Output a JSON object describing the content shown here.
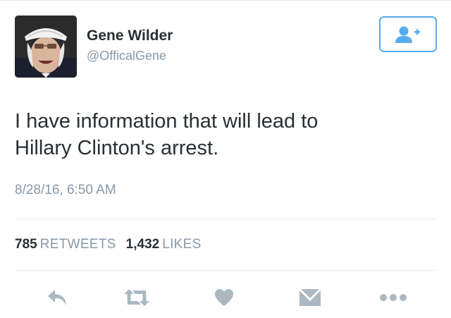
{
  "user": {
    "display_name": "Gene Wilder",
    "handle": "@OfficalGene"
  },
  "follow_button": {
    "icon": "add-user-icon"
  },
  "tweet": {
    "line1": "I have information that will lead to",
    "line2": "Hillary Clinton's arrest.",
    "timestamp": "8/28/16, 6:50 AM"
  },
  "stats": {
    "retweets_count": "785",
    "retweets_label": "RETWEETS",
    "likes_count": "1,432",
    "likes_label": "LIKES"
  },
  "actions": [
    "reply-icon",
    "retweet-icon",
    "like-icon",
    "direct-message-icon",
    "more-icon"
  ],
  "colors": {
    "accent": "#55acee",
    "text": "#292f33",
    "muted": "#8899a6",
    "action_icon": "#aab8c2"
  }
}
